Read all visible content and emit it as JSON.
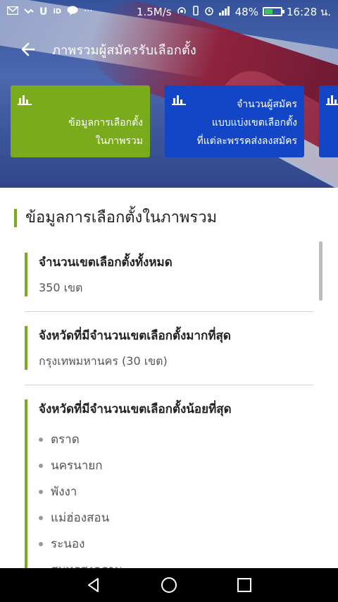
{
  "status_bar": {
    "left_icons": [
      "gmail-icon",
      "missed-call-icon",
      "u-icon",
      "true-id-icon",
      "line-icon",
      "more-icon"
    ],
    "speed": "1.5M/s",
    "battery_percent": "48%",
    "time": "16:28 น."
  },
  "app_bar": {
    "title": "ภาพรวมผู้สมัครรับเลือกตั้ง"
  },
  "cards": [
    {
      "line1": "ข้อมูลการเลือกตั้ง",
      "line2": "ในภาพรวม",
      "line3": "",
      "color": "#7aab1c"
    },
    {
      "line1": "จำนวนผู้สมัคร",
      "line2": "แบบแบ่งเขตเลือกตั้ง",
      "line3": "ที่แต่ละพรรคส่งลงสมัคร",
      "color": "#1346c6"
    }
  ],
  "section": {
    "title": "ข้อมูลการเลือกตั้งในภาพรวม",
    "items": [
      {
        "label": "จำนวนเขตเลือกตั้งทั้งหมด",
        "value": "350 เขต"
      },
      {
        "label": "จังหวัดที่มีจำนวนเขตเลือกตั้งมากที่สุด",
        "value": "กรุงเทพมหานคร (30 เขต)"
      },
      {
        "label": "จังหวัดที่มีจำนวนเขตเลือกตั้งน้อยที่สุด",
        "list": [
          "ตราด",
          "นครนายก",
          "พังงา",
          "แม่ฮ่องสอน",
          "ระนอง",
          "สมุทรสงคราม"
        ]
      }
    ]
  },
  "colors": {
    "accent_green": "#7aab1c",
    "accent_blue": "#1346c6"
  }
}
